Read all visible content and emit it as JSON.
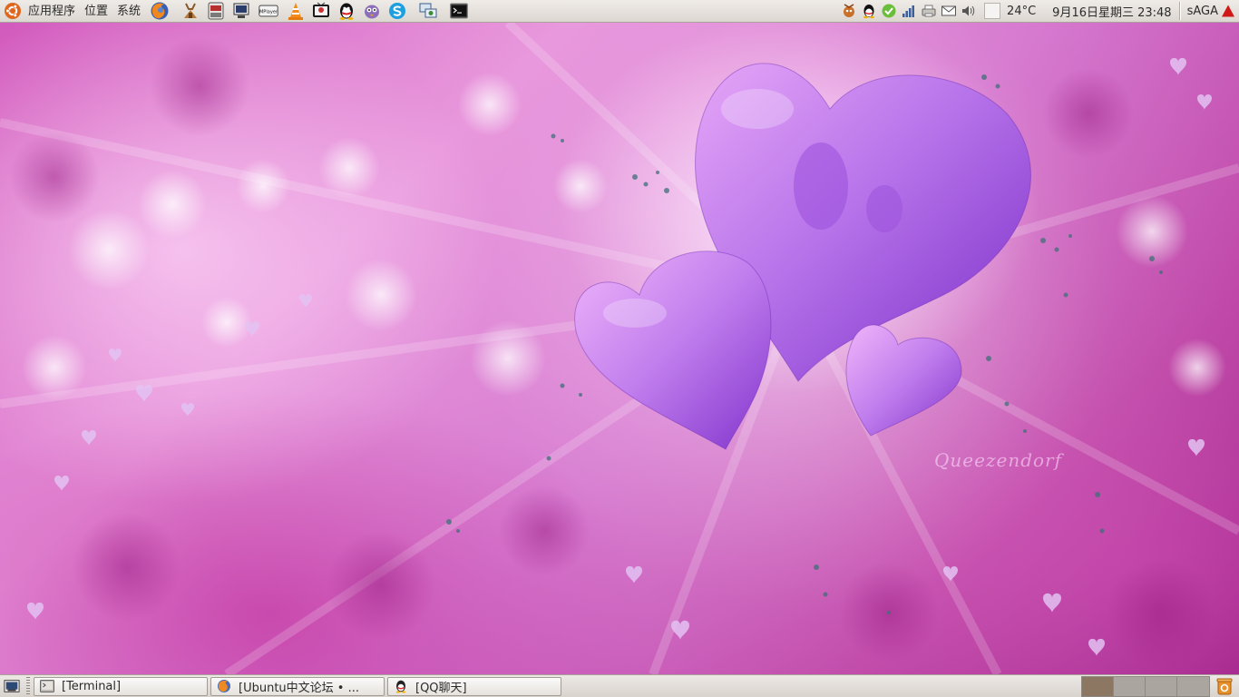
{
  "top_panel": {
    "menus": [
      {
        "label": "应用程序"
      },
      {
        "label": "位置"
      },
      {
        "label": "系统"
      }
    ],
    "launchers": [
      {
        "name": "firefox-icon"
      },
      {
        "name": "bittorrent-icon"
      },
      {
        "name": "screenshot-icon"
      },
      {
        "name": "device-icon"
      },
      {
        "name": "mplayer-icon"
      },
      {
        "name": "vlc-icon"
      },
      {
        "name": "tv-icon"
      },
      {
        "name": "qq-icon"
      },
      {
        "name": "pidgin-icon"
      },
      {
        "name": "skype-icon"
      },
      {
        "name": "network-icon"
      },
      {
        "name": "terminal-icon"
      }
    ],
    "mplayer_label": "MPlayer",
    "tray": {
      "temperature": "24°C",
      "datetime": "9月16日星期三 23:48",
      "user": "sAGA"
    }
  },
  "desktop": {
    "watermark": "Queezendorf",
    "colors": {
      "bg_dark": "#9c2186",
      "bg_light": "#e58fd8",
      "heart": "#b26ee8"
    }
  },
  "bottom_panel": {
    "tasks": [
      {
        "label": "[Terminal]",
        "icon": "terminal-icon"
      },
      {
        "label": "[Ubuntu中文论坛 • ...",
        "icon": "firefox-icon"
      },
      {
        "label": "[QQ聊天]",
        "icon": "qq-icon"
      }
    ],
    "workspaces": 4,
    "active_workspace": 1
  }
}
